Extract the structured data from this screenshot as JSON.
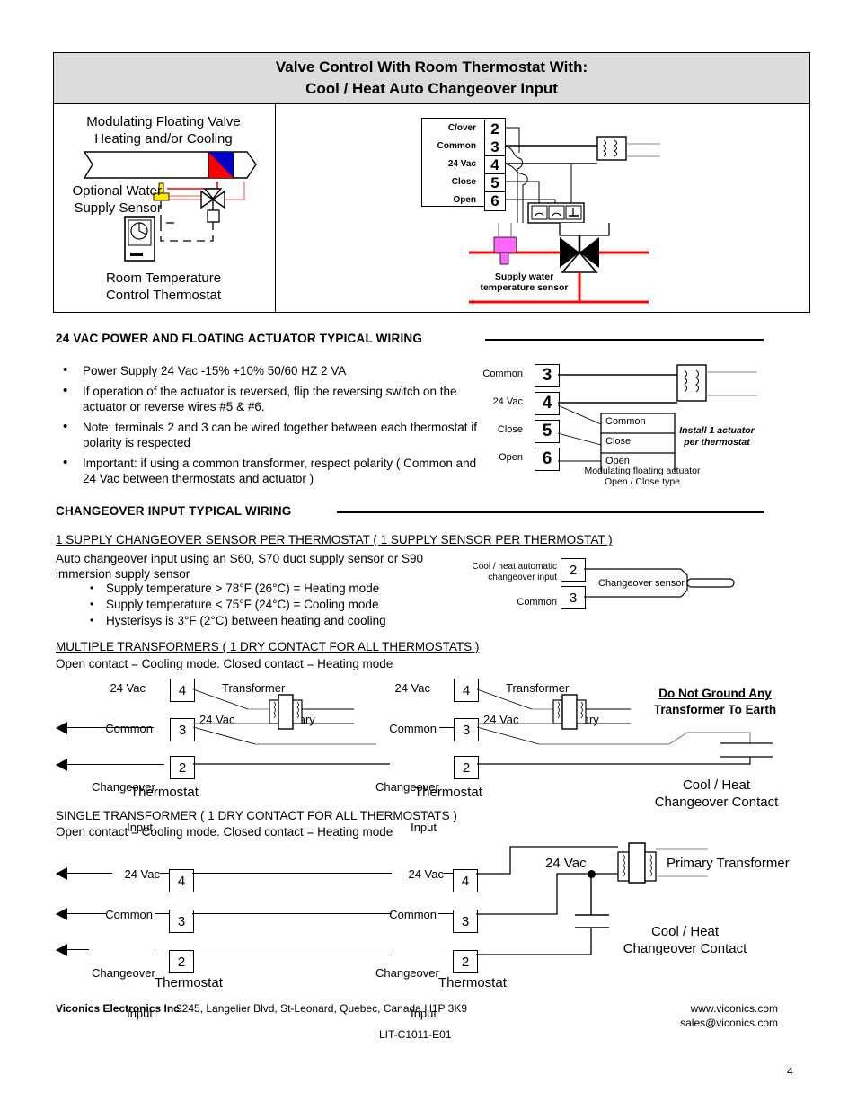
{
  "figure": {
    "title_line1": "Valve Control With Room Thermostat With:",
    "title_line2": "Cool / Heat Auto Changeover Input",
    "left": {
      "valve_caption_l1": "Modulating Floating Valve",
      "valve_caption_l2": "Heating and/or Cooling",
      "sensor_caption_l1": "Optional Water",
      "sensor_caption_l2": "Supply Sensor",
      "thermostat_caption_l1": "Room Temperature",
      "thermostat_caption_l2": "Control Thermostat"
    },
    "right": {
      "terminals": [
        {
          "label": "C/over",
          "number": "2"
        },
        {
          "label": "Common",
          "number": "3"
        },
        {
          "label": "24 Vac",
          "number": "4"
        },
        {
          "label": "Close",
          "number": "5"
        },
        {
          "label": "Open",
          "number": "6"
        }
      ],
      "sensor_caption_l1": "Supply water",
      "sensor_caption_l2": "temperature sensor"
    }
  },
  "section_power": {
    "heading": "24 VAC POWER AND FLOATING ACTUATOR TYPICAL WIRING",
    "bullets": [
      "Power Supply 24 Vac -15% +10% 50/60 HZ 2 VA",
      "If operation of the actuator is reversed, flip the reversing switch on the actuator or reverse wires #5 & #6.",
      "Note: terminals 2 and 3 can be wired together between each thermostat if polarity is respected",
      "Important: if using a common transformer, respect polarity ( Common and 24 Vac between thermostats and actuator )"
    ],
    "diagram": {
      "terminals": [
        {
          "label": "Common",
          "number": "3"
        },
        {
          "label": "24 Vac",
          "number": "4"
        },
        {
          "label": "Close",
          "number": "5"
        },
        {
          "label": "Open",
          "number": "6"
        }
      ],
      "actuator_rows": [
        "Common",
        "Close",
        "Open"
      ],
      "note_l1": "Install 1 actuator",
      "note_l2": "per thermostat",
      "caption_l1": "Modulating floating actuator",
      "caption_l2": "Open / Close type"
    }
  },
  "section_changeover": {
    "heading": "CHANGEOVER INPUT TYPICAL WIRING",
    "sub1": {
      "title": "1 SUPPLY CHANGEOVER SENSOR PER THERMOSTAT ( 1 SUPPLY SENSOR PER THERMOSTAT )",
      "text_l1": "Auto changeover input using an S60, S70 duct supply sensor or S90",
      "text_l2": "immersion supply sensor",
      "bullets": [
        "Supply temperature > 78°F (26°C) = Heating mode",
        "Supply temperature < 75°F (24°C) = Cooling mode",
        "Hysterisys is 3°F (2°C) between heating and cooling"
      ],
      "diagram": {
        "label2_l1": "Cool / heat automatic",
        "label2_l2": "changeover input",
        "term2": "2",
        "label3": "Common",
        "term3": "3",
        "sensor_label": "Changeover sensor"
      }
    },
    "sub2": {
      "title": "MULTIPLE TRANSFORMERS ( 1 DRY CONTACT FOR ALL THERMOSTATS )",
      "text": "Open contact = Cooling mode. Closed contact = Heating mode",
      "thermostat_label": "Thermostat",
      "rows": [
        {
          "label": "24 Vac",
          "number": "4"
        },
        {
          "label": "Common",
          "number": "3"
        },
        {
          "label_l1": "Changeover",
          "label_l2": "Input",
          "number": "2"
        }
      ],
      "transformer_label": "Transformer",
      "transformer_24vac": "24 Vac",
      "transformer_primary": "Primary",
      "warning_l1": "Do Not Ground Any",
      "warning_l2": "Transformer To Earth",
      "contact_l1": "Cool / Heat",
      "contact_l2": "Changeover Contact"
    },
    "sub3": {
      "title": "SINGLE TRANSFORMER ( 1 DRY CONTACT FOR ALL THERMOSTATS )",
      "text": "Open contact = Cooling mode. Closed contact = Heating mode",
      "thermostat_label": "Thermostat",
      "rows": [
        {
          "label": "24 Vac",
          "number": "4"
        },
        {
          "label": "Common",
          "number": "3"
        },
        {
          "label_l1": "Changeover",
          "label_l2": "Input",
          "number": "2"
        }
      ],
      "supply_label": "24 Vac",
      "primary_label": "Primary Transformer",
      "contact_l1": "Cool / Heat",
      "contact_l2": "Changeover Contact"
    }
  },
  "footer": {
    "company": "Viconics Electronics Inc.",
    "address": "9245, Langelier Blvd, St-Leonard, Quebec, Canada H1P 3K9",
    "website": "www.viconics.com",
    "email": "sales@viconics.com",
    "doc_id": "LIT-C1011-E01",
    "page_number": "4"
  }
}
